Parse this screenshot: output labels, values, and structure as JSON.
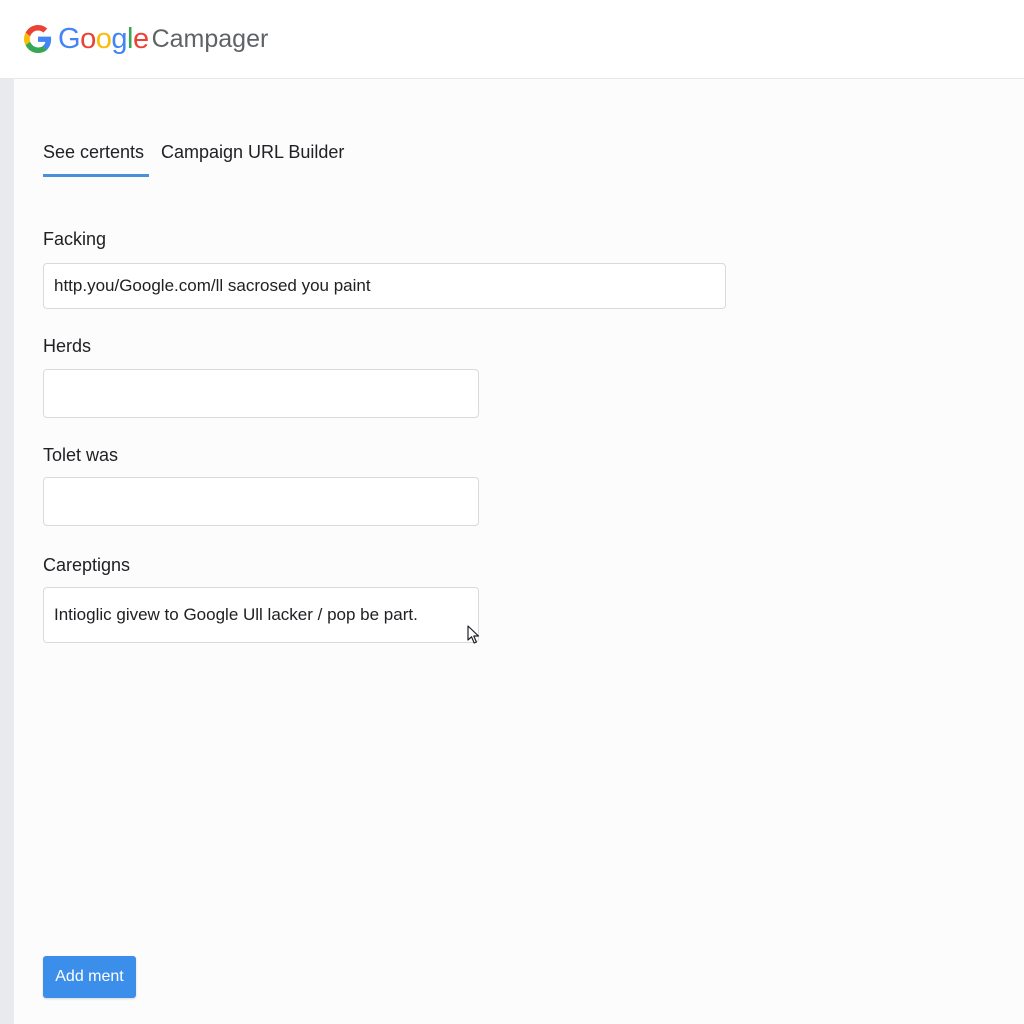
{
  "header": {
    "logo_icon": "google-g-icon",
    "wordmark_letters": [
      {
        "char": "G",
        "color": "#4285F4"
      },
      {
        "char": "o",
        "color": "#EA4335"
      },
      {
        "char": "o",
        "color": "#FBBC05"
      },
      {
        "char": "g",
        "color": "#4285F4"
      },
      {
        "char": "l",
        "color": "#34A853"
      },
      {
        "char": "e",
        "color": "#EA4335"
      }
    ],
    "product_name": "Campager"
  },
  "tabs": [
    {
      "label": "See certents",
      "active": true
    },
    {
      "label": "Campaign URL Builder",
      "active": false
    }
  ],
  "fields": {
    "facking": {
      "label": "Facking",
      "value": "http.you/Google.com/ll sacrosed you paint"
    },
    "herds": {
      "label": "Herds",
      "value": ""
    },
    "tolet_was": {
      "label": "Tolet was",
      "value": ""
    },
    "careptigns": {
      "label": "Careptigns",
      "value": "Intioglic givew to Google Ull lacker / pop be part."
    }
  },
  "actions": {
    "add_label": "Add ment"
  },
  "colors": {
    "accent": "#3b8fea",
    "tab_underline": "#4a90d9",
    "border": "#d7dade"
  },
  "icons": {
    "cursor": "mouse-pointer-icon"
  }
}
